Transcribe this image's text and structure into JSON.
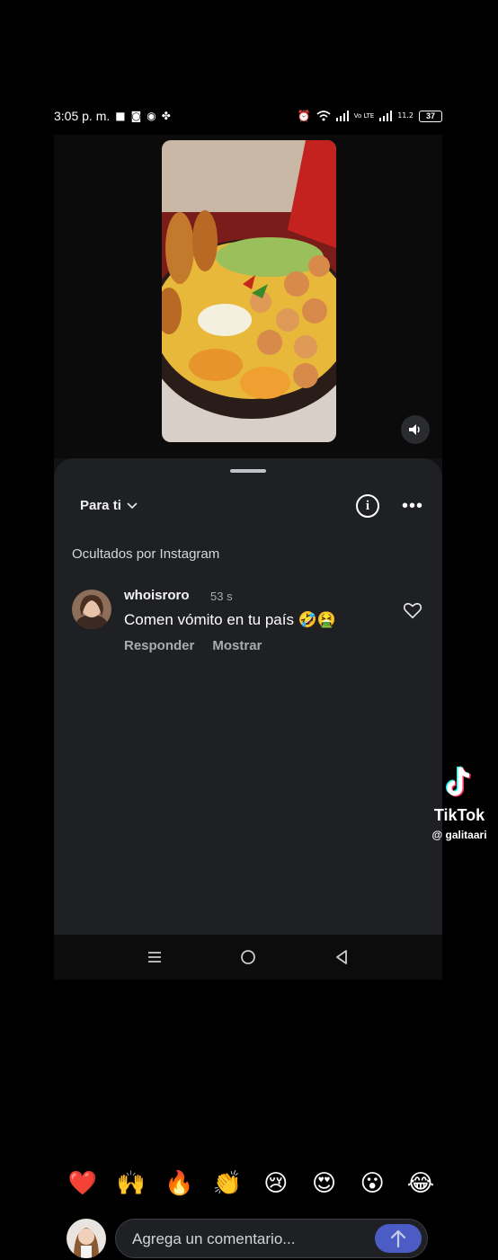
{
  "status_bar": {
    "time": "3:05 p. m.",
    "left_icons": [
      "video-icon",
      "instagram-icon",
      "whatsapp-icon",
      "pinwheel-icon"
    ],
    "right_icons": [
      "alarm-icon",
      "wifi-icon",
      "signal-icon",
      "volte-icon",
      "signal-icon"
    ],
    "volte_label": "Vo LTE",
    "net_speed": "11.2",
    "battery": "37"
  },
  "sheet": {
    "filter_label": "Para ti",
    "info_icon": "info-icon",
    "more_icon": "more-icon",
    "hidden_notice": "Ocultados por Instagram"
  },
  "comment": {
    "username": "whoisroro",
    "time": "53 s",
    "text": "Comen vómito en tu país 🤣🤮",
    "reply_label": "Responder",
    "show_label": "Mostrar"
  },
  "reactions": [
    "❤️",
    "🙌",
    "🔥",
    "👏",
    "😢",
    "😍",
    "😮",
    "😂"
  ],
  "compose": {
    "placeholder": "Agrega un comentario..."
  },
  "watermark": {
    "brand": "TikTok",
    "user": "@ galitaari"
  },
  "nav": [
    "menu-icon",
    "home-icon",
    "back-icon"
  ],
  "colors": {
    "sheet_bg": "#1f2023",
    "send_button": "#4b5cc4",
    "muted_text": "#a9abb0"
  }
}
